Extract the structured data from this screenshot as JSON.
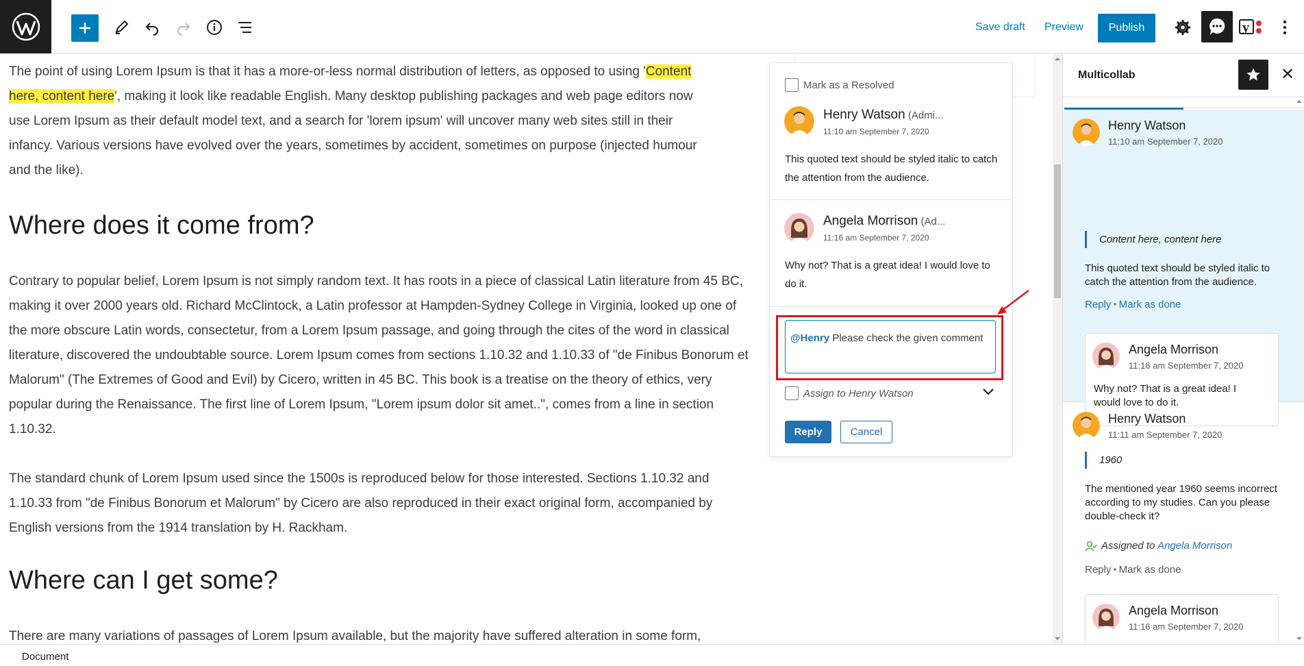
{
  "toolbar": {
    "save_draft": "Save draft",
    "preview": "Preview",
    "publish": "Publish"
  },
  "editor": {
    "para1_start": "The point of using Lorem Ipsum is that it has a more-or-less normal distribution of letters, as opposed to using '",
    "para1_highlight_a": "Content",
    "para1_highlight_b": "here, content here",
    "para1_end": "', making it look like readable English. Many desktop publishing packages and web page editors now",
    "para1_line3": "use Lorem Ipsum as their default model text, and a search for 'lorem ipsum' will uncover many web sites still in their",
    "para1_line4": "infancy. Various versions have evolved over the years, sometimes by accident, sometimes on purpose (injected humour",
    "para1_line5": "and the like).",
    "heading1": "Where does it come from?",
    "para2": "Contrary to popular belief, Lorem Ipsum is not simply random text. It has roots in a piece of classical Latin literature from 45 BC, making it over 2000 years old. Richard McClintock, a Latin professor at Hampden-Sydney College in Virginia, looked up one of the more obscure Latin words, consectetur, from a Lorem Ipsum passage, and going through the cites of the word in classical literature, discovered the undoubtable source. Lorem Ipsum comes from sections 1.10.32 and 1.10.33 of \"de Finibus Bonorum et Malorum\" (The Extremes of Good and Evil) by Cicero, written in 45 BC. This book is a treatise on the theory of ethics, very popular during the Renaissance. The first line of Lorem Ipsum, \"Lorem ipsum dolor sit amet..\", comes from a line in section 1.10.32.",
    "para3": "The standard chunk of Lorem Ipsum used since the 1500s is reproduced below for those interested. Sections 1.10.32 and 1.10.33 from \"de Finibus Bonorum et Malorum\" by Cicero are also reproduced in their exact original form, accompanied by English versions from the 1914 translation by H. Rackham.",
    "heading2": "Where can I get some?",
    "para4": "There are many variations of passages of Lorem Ipsum available, but the majority have suffered alteration in some form,"
  },
  "popup": {
    "mark_resolved": "Mark as a Resolved",
    "comment1": {
      "name": "Henry Watson",
      "role": " (Admi...",
      "time": "11:10 am September 7, 2020",
      "text": "This quoted text should be styled italic to catch the attention from the audience."
    },
    "comment2": {
      "name": "Angela Morrison",
      "role": " (Ad...",
      "time": "11:16 am September 7, 2020",
      "text": "Why not? That is a great idea! I would love to do it."
    },
    "reply_mention": "@Henry",
    "reply_text": " Please check the given comment",
    "assign_label": "Assign to Henry Watson",
    "reply_button": "Reply",
    "cancel_button": "Cancel"
  },
  "sidebar": {
    "title": "Multicollab",
    "thread1": {
      "name": "Henry Watson",
      "time": "11:10 am September 7, 2020",
      "quote": "Content here, content here",
      "text": "This quoted text should be styled italic to catch the attention from the audience.",
      "reply": "Reply",
      "mark_done": "Mark as done",
      "reply_card": {
        "name": "Angela Morrison",
        "time": "11:16 am September 7, 2020",
        "text": "Why not? That is a great idea! I would love to do it."
      }
    },
    "thread2": {
      "name": "Henry Watson",
      "time": "11:11 am September 7, 2020",
      "quote": "1960",
      "text": "The mentioned year 1960 seems incorrect according to my studies. Can you please double-check it?",
      "assigned_prefix": "Assigned to ",
      "assigned_name": "Angela Morrison",
      "reply": "Reply",
      "mark_done": "Mark as done",
      "reply_card": {
        "name": "Angela Morrison",
        "time": "11:16 am September 7, 2020"
      }
    }
  },
  "footer": {
    "breadcrumb": "Document"
  },
  "colors": {
    "accent": "#007cba",
    "highlight": "#ffef3c",
    "annotation": "#e0141e",
    "thread_active_bg": "#e5f3fa"
  }
}
